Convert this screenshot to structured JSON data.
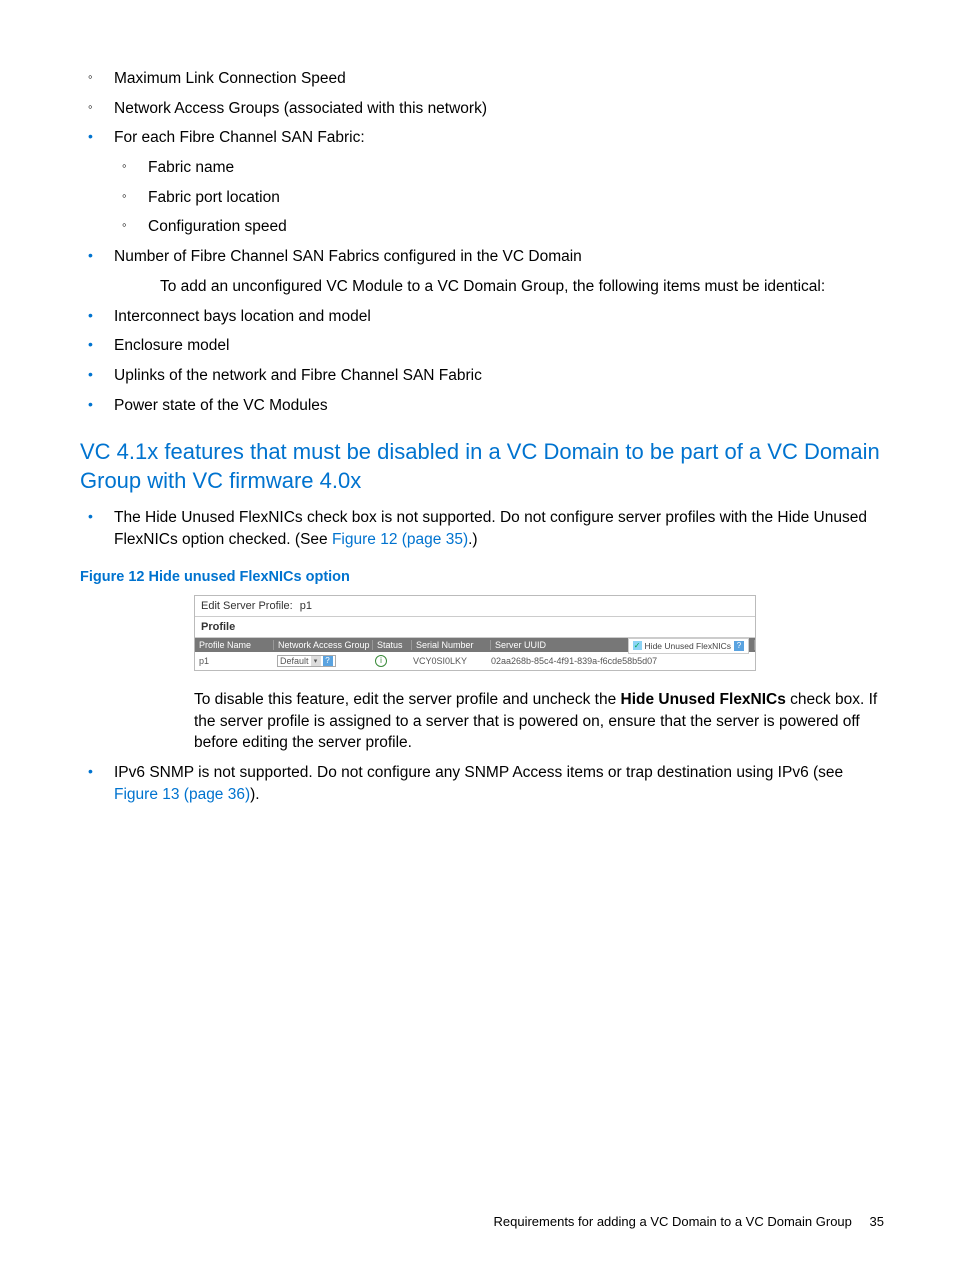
{
  "top_sublist": [
    "Maximum Link Connection Speed",
    "Network Access Groups (associated with this network)"
  ],
  "fc_item_label": "For each Fibre Channel SAN Fabric:",
  "fc_sublist": [
    "Fabric name",
    "Fabric port location",
    "Configuration speed"
  ],
  "num_fc_item": "Number of Fibre Channel SAN Fabrics configured in the VC Domain",
  "add_unconfigured_para": "To add an unconfigured VC Module to a VC Domain Group, the following items must be identical:",
  "identical_items": [
    "Interconnect bays location and model",
    "Enclosure model",
    "Uplinks of the network and Fibre Channel SAN Fabric",
    "Power state of the VC Modules"
  ],
  "section_title": "VC 4.1x features that must be disabled in a VC Domain to be part of a VC Domain Group with VC firmware 4.0x",
  "feature_bullet1_a": "The Hide Unused FlexNICs check box is not supported. Do not configure server profiles with the Hide Unused FlexNICs option checked. (See ",
  "feature_bullet1_link": "Figure 12 (page 35)",
  "feature_bullet1_b": ".)",
  "figure_caption": "Figure 12 Hide unused FlexNICs option",
  "figure": {
    "edit_label": "Edit Server Profile:",
    "edit_value": "p1",
    "profile_label": "Profile",
    "headers": {
      "profile_name": "Profile Name",
      "nag": "Network Access Group",
      "status": "Status",
      "serial": "Serial Number",
      "uuid": "Server UUID"
    },
    "row": {
      "profile_name": "p1",
      "nag_value": "Default",
      "serial": "VCY0SI0LKY",
      "uuid": "02aa268b-85c4-4f91-839a-f6cde58b5d07"
    },
    "hide_flexnics_label": "Hide Unused FlexNICs"
  },
  "disable_para_a": "To disable this feature, edit the server profile and uncheck the ",
  "disable_para_bold": "Hide Unused FlexNICs",
  "disable_para_b": " check box. If the server profile is assigned to a server that is powered on, ensure that the server is powered off before editing the server profile.",
  "feature_bullet2_a": "IPv6 SNMP is not supported. Do not configure any SNMP Access items or trap destination using IPv6 (see ",
  "feature_bullet2_link": "Figure 13 (page 36)",
  "feature_bullet2_b": ").",
  "footer_text": "Requirements for adding a VC Domain to a VC Domain Group",
  "footer_page": "35"
}
